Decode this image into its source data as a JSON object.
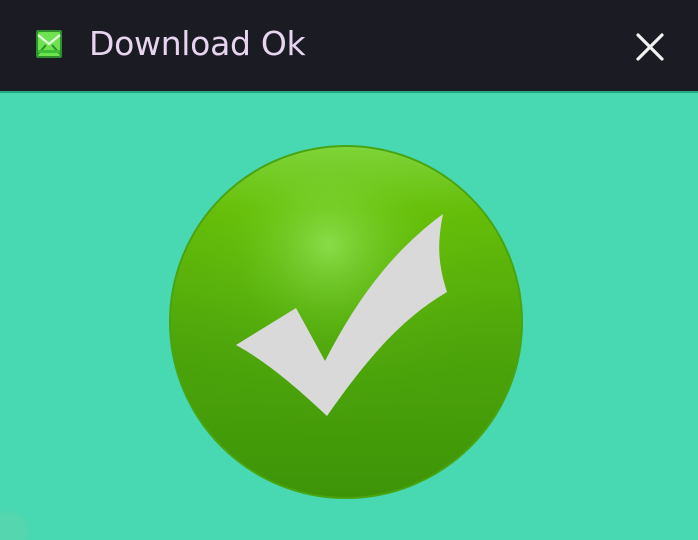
{
  "window": {
    "title": "Download Ok",
    "app_icon": "green-envelope-icon",
    "close_icon": "close-icon"
  },
  "content": {
    "status_icon": "success-checkmark-icon"
  },
  "colors": {
    "titlebar_background": "#1b1b24",
    "title_text": "#e7d5ef",
    "content_background": "#48d8b2",
    "success_green": "#56b10d",
    "checkmark_gray": "#d9d9d9"
  }
}
